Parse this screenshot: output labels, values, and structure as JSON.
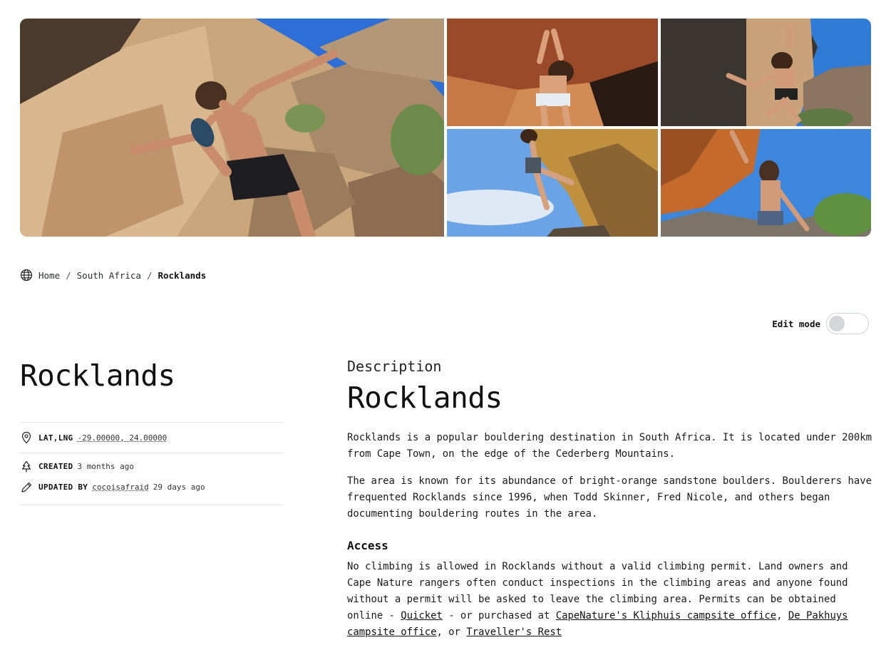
{
  "gallery": {
    "photos": [
      {
        "name": "climber-main-photo"
      },
      {
        "name": "climber-photo-2"
      },
      {
        "name": "climber-photo-3"
      },
      {
        "name": "climber-photo-4"
      },
      {
        "name": "climber-photo-5"
      }
    ]
  },
  "breadcrumb": {
    "icon": "globe-icon",
    "separator": "/",
    "items": [
      "Home",
      "South Africa",
      "Rocklands"
    ]
  },
  "edit_mode": {
    "label": "Edit mode",
    "enabled": false
  },
  "area": {
    "title": "Rocklands",
    "coords_label": "LAT,LNG",
    "coords_value": "-29.00000, 24.00000",
    "created_label": "CREATED",
    "created_value": "3 months ago",
    "updated_label": "UPDATED BY",
    "updated_user": "cocoisafraid",
    "updated_value": "29 days ago"
  },
  "description": {
    "kicker": "Description",
    "heading": "Rocklands",
    "para1": "Rocklands is a popular bouldering destination in South Africa. It is located under 200km from Cape Town, on the edge of the Cederberg Mountains.",
    "para2": "The area is known for its abundance of bright-orange sandstone boulders. Boulderers have frequented Rocklands since 1996, when Todd Skinner, Fred Nicole, and others began documenting bouldering routes in the area.",
    "access_heading": "Access",
    "access_text_1": "No climbing is allowed in Rocklands without a valid climbing permit. Land owners and Cape Nature rangers often conduct inspections in the climbing areas and anyone found without a permit will be asked to leave the climbing area. Permits can be obtained online - ",
    "access_link_1": "Quicket",
    "access_text_2": " - or purchased at ",
    "access_link_2": "CapeNature's Kliphuis campsite office",
    "access_text_3": ", ",
    "access_link_3": "De Pakhuys campsite office",
    "access_text_4": ", or ",
    "access_link_4": "Traveller's Rest"
  }
}
